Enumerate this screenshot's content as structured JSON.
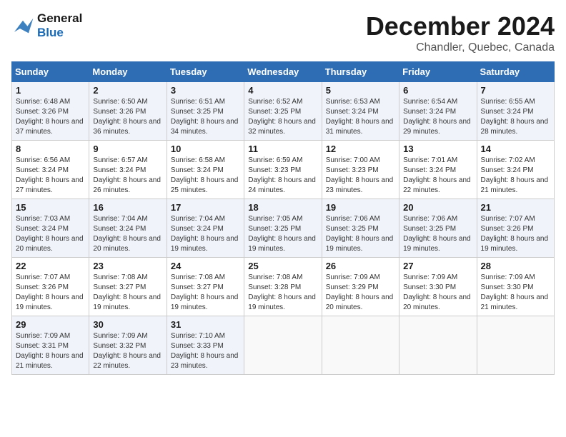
{
  "logo": {
    "line1": "General",
    "line2": "Blue"
  },
  "title": "December 2024",
  "subtitle": "Chandler, Quebec, Canada",
  "header": {
    "colors": {
      "accent": "#2e6db4"
    }
  },
  "days_of_week": [
    "Sunday",
    "Monday",
    "Tuesday",
    "Wednesday",
    "Thursday",
    "Friday",
    "Saturday"
  ],
  "weeks": [
    [
      {
        "day": "1",
        "sunrise": "6:48 AM",
        "sunset": "3:26 PM",
        "daylight": "8 hours and 37 minutes."
      },
      {
        "day": "2",
        "sunrise": "6:50 AM",
        "sunset": "3:26 PM",
        "daylight": "8 hours and 36 minutes."
      },
      {
        "day": "3",
        "sunrise": "6:51 AM",
        "sunset": "3:25 PM",
        "daylight": "8 hours and 34 minutes."
      },
      {
        "day": "4",
        "sunrise": "6:52 AM",
        "sunset": "3:25 PM",
        "daylight": "8 hours and 32 minutes."
      },
      {
        "day": "5",
        "sunrise": "6:53 AM",
        "sunset": "3:24 PM",
        "daylight": "8 hours and 31 minutes."
      },
      {
        "day": "6",
        "sunrise": "6:54 AM",
        "sunset": "3:24 PM",
        "daylight": "8 hours and 29 minutes."
      },
      {
        "day": "7",
        "sunrise": "6:55 AM",
        "sunset": "3:24 PM",
        "daylight": "8 hours and 28 minutes."
      }
    ],
    [
      {
        "day": "8",
        "sunrise": "6:56 AM",
        "sunset": "3:24 PM",
        "daylight": "8 hours and 27 minutes."
      },
      {
        "day": "9",
        "sunrise": "6:57 AM",
        "sunset": "3:24 PM",
        "daylight": "8 hours and 26 minutes."
      },
      {
        "day": "10",
        "sunrise": "6:58 AM",
        "sunset": "3:24 PM",
        "daylight": "8 hours and 25 minutes."
      },
      {
        "day": "11",
        "sunrise": "6:59 AM",
        "sunset": "3:23 PM",
        "daylight": "8 hours and 24 minutes."
      },
      {
        "day": "12",
        "sunrise": "7:00 AM",
        "sunset": "3:23 PM",
        "daylight": "8 hours and 23 minutes."
      },
      {
        "day": "13",
        "sunrise": "7:01 AM",
        "sunset": "3:24 PM",
        "daylight": "8 hours and 22 minutes."
      },
      {
        "day": "14",
        "sunrise": "7:02 AM",
        "sunset": "3:24 PM",
        "daylight": "8 hours and 21 minutes."
      }
    ],
    [
      {
        "day": "15",
        "sunrise": "7:03 AM",
        "sunset": "3:24 PM",
        "daylight": "8 hours and 20 minutes."
      },
      {
        "day": "16",
        "sunrise": "7:04 AM",
        "sunset": "3:24 PM",
        "daylight": "8 hours and 20 minutes."
      },
      {
        "day": "17",
        "sunrise": "7:04 AM",
        "sunset": "3:24 PM",
        "daylight": "8 hours and 19 minutes."
      },
      {
        "day": "18",
        "sunrise": "7:05 AM",
        "sunset": "3:25 PM",
        "daylight": "8 hours and 19 minutes."
      },
      {
        "day": "19",
        "sunrise": "7:06 AM",
        "sunset": "3:25 PM",
        "daylight": "8 hours and 19 minutes."
      },
      {
        "day": "20",
        "sunrise": "7:06 AM",
        "sunset": "3:25 PM",
        "daylight": "8 hours and 19 minutes."
      },
      {
        "day": "21",
        "sunrise": "7:07 AM",
        "sunset": "3:26 PM",
        "daylight": "8 hours and 19 minutes."
      }
    ],
    [
      {
        "day": "22",
        "sunrise": "7:07 AM",
        "sunset": "3:26 PM",
        "daylight": "8 hours and 19 minutes."
      },
      {
        "day": "23",
        "sunrise": "7:08 AM",
        "sunset": "3:27 PM",
        "daylight": "8 hours and 19 minutes."
      },
      {
        "day": "24",
        "sunrise": "7:08 AM",
        "sunset": "3:27 PM",
        "daylight": "8 hours and 19 minutes."
      },
      {
        "day": "25",
        "sunrise": "7:08 AM",
        "sunset": "3:28 PM",
        "daylight": "8 hours and 19 minutes."
      },
      {
        "day": "26",
        "sunrise": "7:09 AM",
        "sunset": "3:29 PM",
        "daylight": "8 hours and 20 minutes."
      },
      {
        "day": "27",
        "sunrise": "7:09 AM",
        "sunset": "3:30 PM",
        "daylight": "8 hours and 20 minutes."
      },
      {
        "day": "28",
        "sunrise": "7:09 AM",
        "sunset": "3:30 PM",
        "daylight": "8 hours and 21 minutes."
      }
    ],
    [
      {
        "day": "29",
        "sunrise": "7:09 AM",
        "sunset": "3:31 PM",
        "daylight": "8 hours and 21 minutes."
      },
      {
        "day": "30",
        "sunrise": "7:09 AM",
        "sunset": "3:32 PM",
        "daylight": "8 hours and 22 minutes."
      },
      {
        "day": "31",
        "sunrise": "7:10 AM",
        "sunset": "3:33 PM",
        "daylight": "8 hours and 23 minutes."
      },
      null,
      null,
      null,
      null
    ]
  ]
}
